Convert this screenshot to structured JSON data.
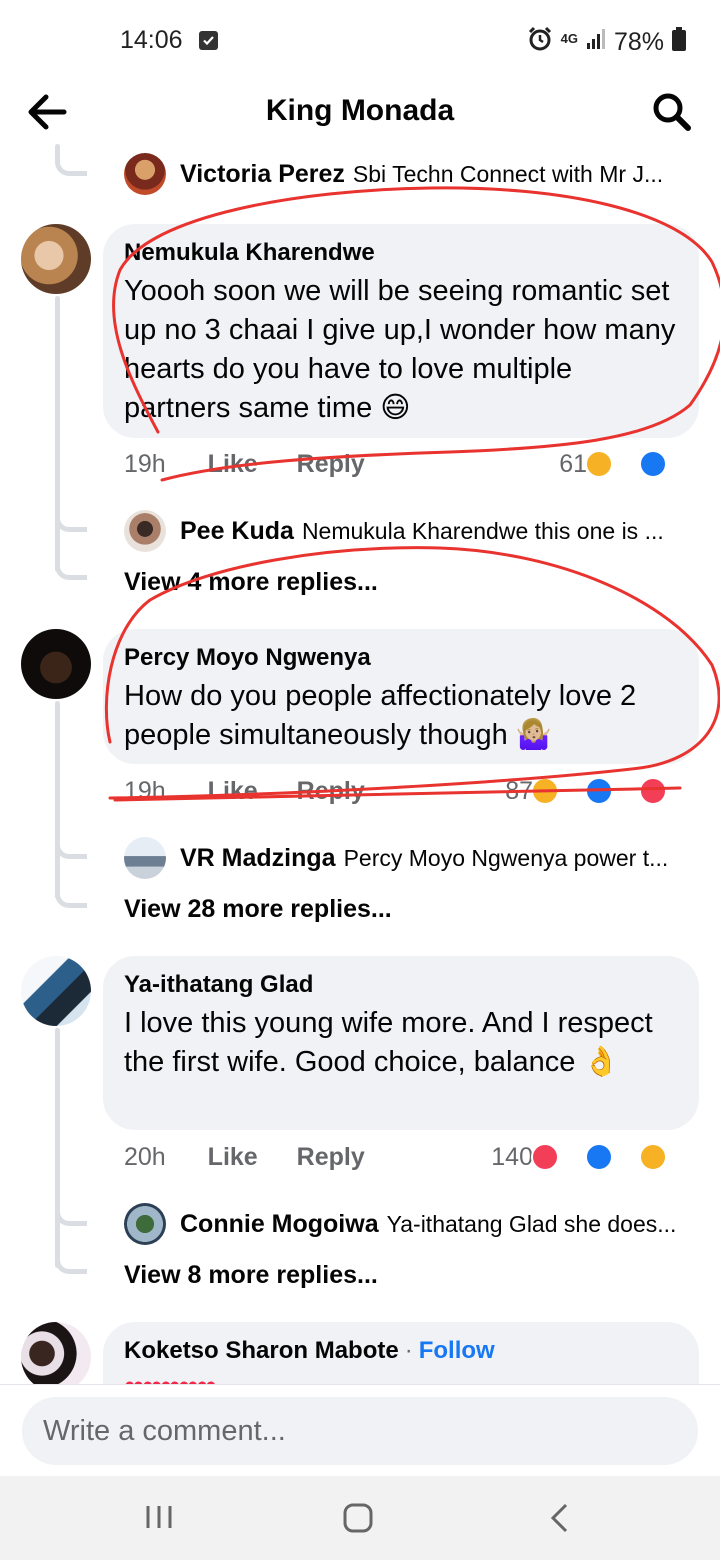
{
  "status_bar": {
    "time": "14:06",
    "network": "4G",
    "battery": "78%"
  },
  "header": {
    "title": "King Monada"
  },
  "comments": [
    {
      "reply_preview": {
        "name": "Victoria Perez",
        "text": "Sbi Techn Connect with Mr J..."
      }
    },
    {
      "name": "Nemukula Kharendwe",
      "text": "Yoooh soon we will be seeing romantic set up no 3 chaai I give up,I wonder how many hearts do you have to love multiple partners same time 😄",
      "time": "19h",
      "like": "Like",
      "reply": "Reply",
      "reactions": "61",
      "reply_preview": {
        "name": "Pee Kuda",
        "text": "Nemukula Kharendwe this one is ..."
      },
      "view_more": "View 4 more replies..."
    },
    {
      "name": "Percy Moyo Ngwenya",
      "text": "How do you people affectionately love 2 people simultaneously though 🤷🏼‍♀️",
      "time": "19h",
      "like": "Like",
      "reply": "Reply",
      "reactions": "87",
      "reply_preview": {
        "name": "VR Madzinga",
        "text": "Percy Moyo Ngwenya power t..."
      },
      "view_more": "View 28 more replies..."
    },
    {
      "name": "Ya-ithatang Glad",
      "text": "I love this young wife more. And I respect the first wife. Good choice, balance 👌",
      "time": "20h",
      "like": "Like",
      "reply": "Reply",
      "reactions": "140",
      "reply_preview": {
        "name": "Connie Mogoiwa",
        "text": "Ya-ithatang Glad she does..."
      },
      "view_more": "View 8 more replies..."
    },
    {
      "name": "Koketso Sharon Mabote",
      "follow": "Follow",
      "text": "❤❤❤❤❤"
    }
  ],
  "composer": {
    "placeholder": "Write a comment..."
  },
  "colors": {
    "accent": "#1877f2",
    "bubble": "#f0f2f5",
    "muted": "#65676b",
    "annotation": "#e8332f"
  }
}
